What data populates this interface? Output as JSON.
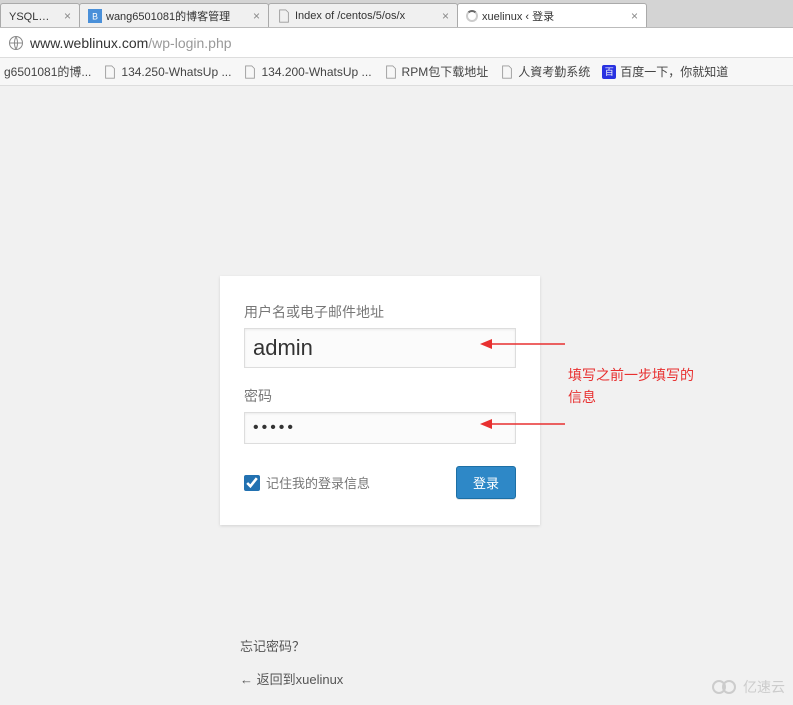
{
  "tabs": [
    {
      "title": "YSQL、PHP",
      "favicon": "none"
    },
    {
      "title": "wang6501081的博客管理",
      "favicon": "blog"
    },
    {
      "title": "Index of /centos/5/os/x",
      "favicon": "page"
    },
    {
      "title": "xuelinux ‹ 登录",
      "favicon": "loading",
      "active": true
    }
  ],
  "url": {
    "host": "www.weblinux.com",
    "path": "/wp-login.php"
  },
  "bookmarks": [
    {
      "label": "g6501081的博...",
      "icon": "page"
    },
    {
      "label": "134.250-WhatsUp ...",
      "icon": "page"
    },
    {
      "label": "134.200-WhatsUp ...",
      "icon": "page"
    },
    {
      "label": "RPM包下载地址",
      "icon": "page"
    },
    {
      "label": "人資考勤系统",
      "icon": "page"
    },
    {
      "label": "百度一下，你就知道",
      "icon": "baidu"
    }
  ],
  "form": {
    "username_label": "用户名或电子邮件地址",
    "username_value": "admin",
    "password_label": "密码",
    "password_value": "•••••",
    "remember_label": "记住我的登录信息",
    "submit_label": "登录"
  },
  "links": {
    "forgot": "忘记密码？",
    "back": "← 返回到xuelinux"
  },
  "annotation": {
    "text1": "填写之前一步填写的",
    "text2": "信息"
  },
  "watermark": "亿速云"
}
